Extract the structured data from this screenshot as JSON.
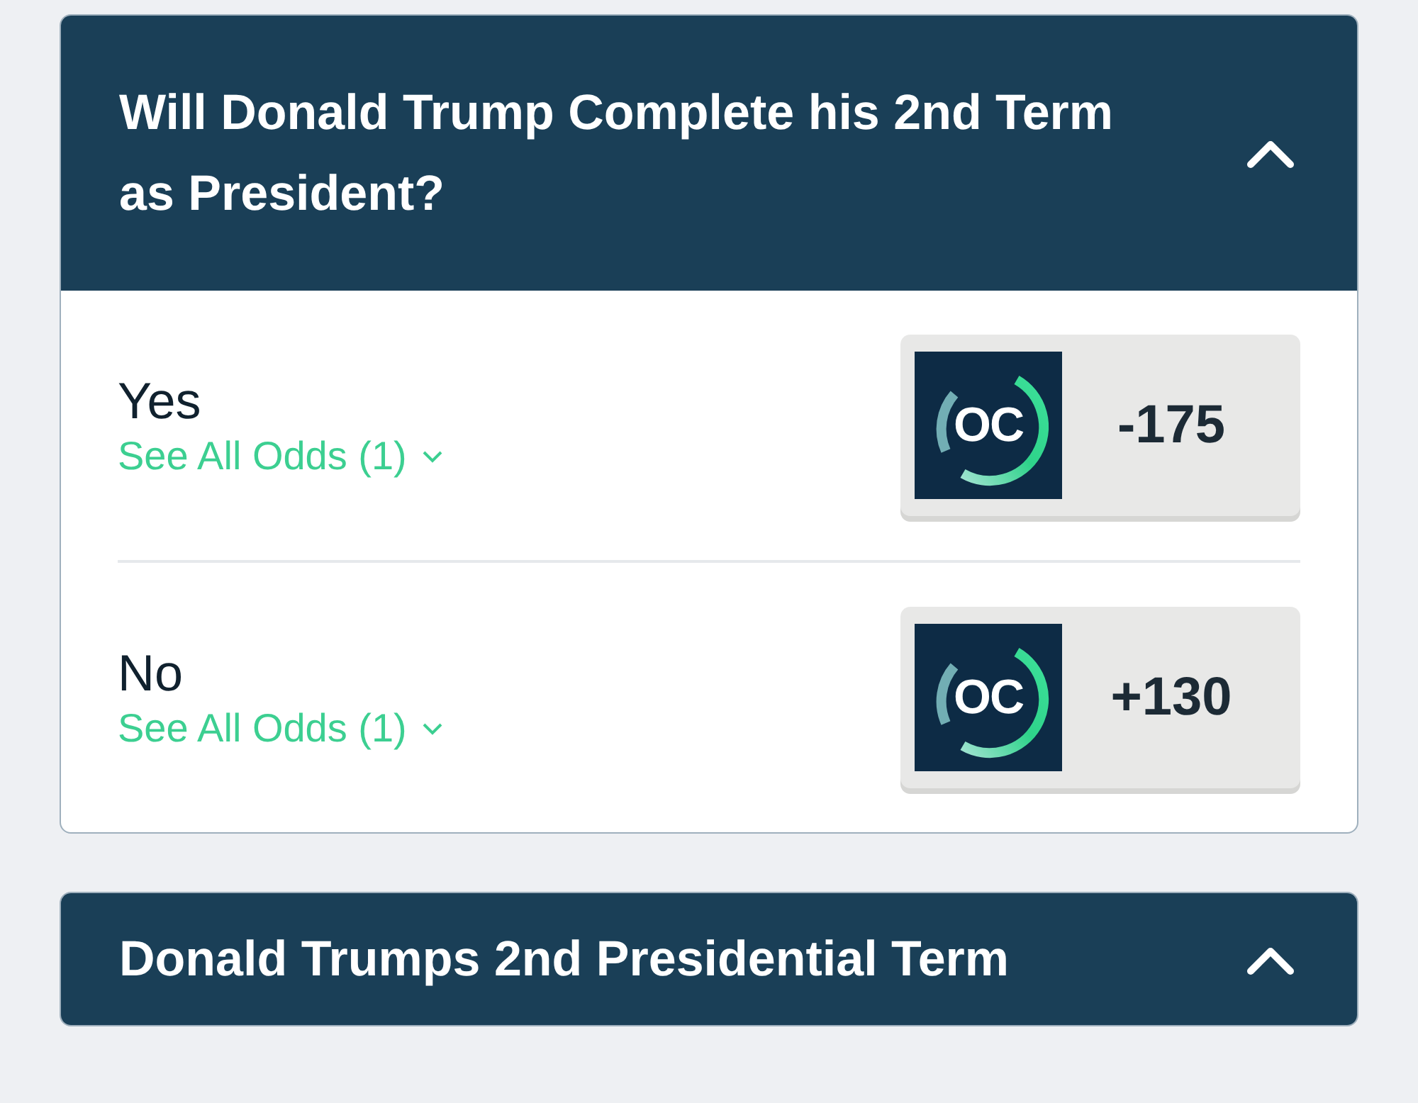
{
  "markets": [
    {
      "title": "Will Donald Trump Complete his 2nd Term as President?",
      "expanded": true,
      "outcomes": [
        {
          "name": "Yes",
          "link": "See All Odds (1)",
          "logo_text": "OC",
          "odds": "-175"
        },
        {
          "name": "No",
          "link": "See All Odds (1)",
          "logo_text": "OC",
          "odds": "+130"
        }
      ]
    },
    {
      "title": "Donald Trumps 2nd Presidential Term",
      "expanded": true
    }
  ]
}
